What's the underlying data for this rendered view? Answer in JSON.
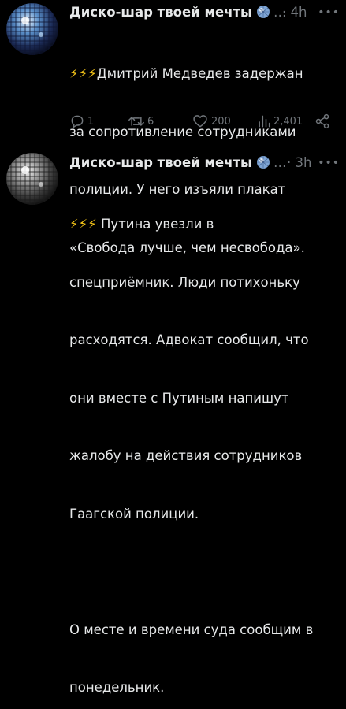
{
  "tweets": [
    {
      "author": "Диско-шар твоей мечты",
      "ellipsis": "…",
      "time": "· 4h",
      "bolts": "⚡⚡⚡",
      "lines": [
        "Дмитрий Медведев задержан",
        "за сопротивление сотрудниками",
        "полиции. У него изъяли плакат",
        "«Свобода лучше, чем несвобода»."
      ],
      "replies": "1",
      "retweets": "6",
      "likes": "200",
      "views": "2,401"
    },
    {
      "author": "Диско-шар твоей мечты",
      "ellipsis": "…",
      "time": "· 3h",
      "bolts": "⚡⚡⚡",
      "lines": [
        "Путина увезли в",
        "спецприёмник. Люди потихоньку",
        "расходятся. Адвокат сообщил, что",
        "они вместе с Путиным напишут",
        "жалобу на действия сотрудников",
        "Гаагской полиции.",
        "",
        "О месте и времени суда сообщим в",
        "понедельник."
      ]
    }
  ],
  "colors": {
    "background": "#000000",
    "text": "#e7e9ea",
    "muted": "#71767b",
    "bolt": "#f5c518"
  },
  "icons": {
    "avatar": "disco-ball",
    "badge": "disco-ball",
    "reply": "speech-bubble-icon",
    "retweet": "retweet-icon",
    "like": "heart-icon",
    "views": "bar-chart-icon",
    "share": "share-icon",
    "more": "dots-icon"
  }
}
